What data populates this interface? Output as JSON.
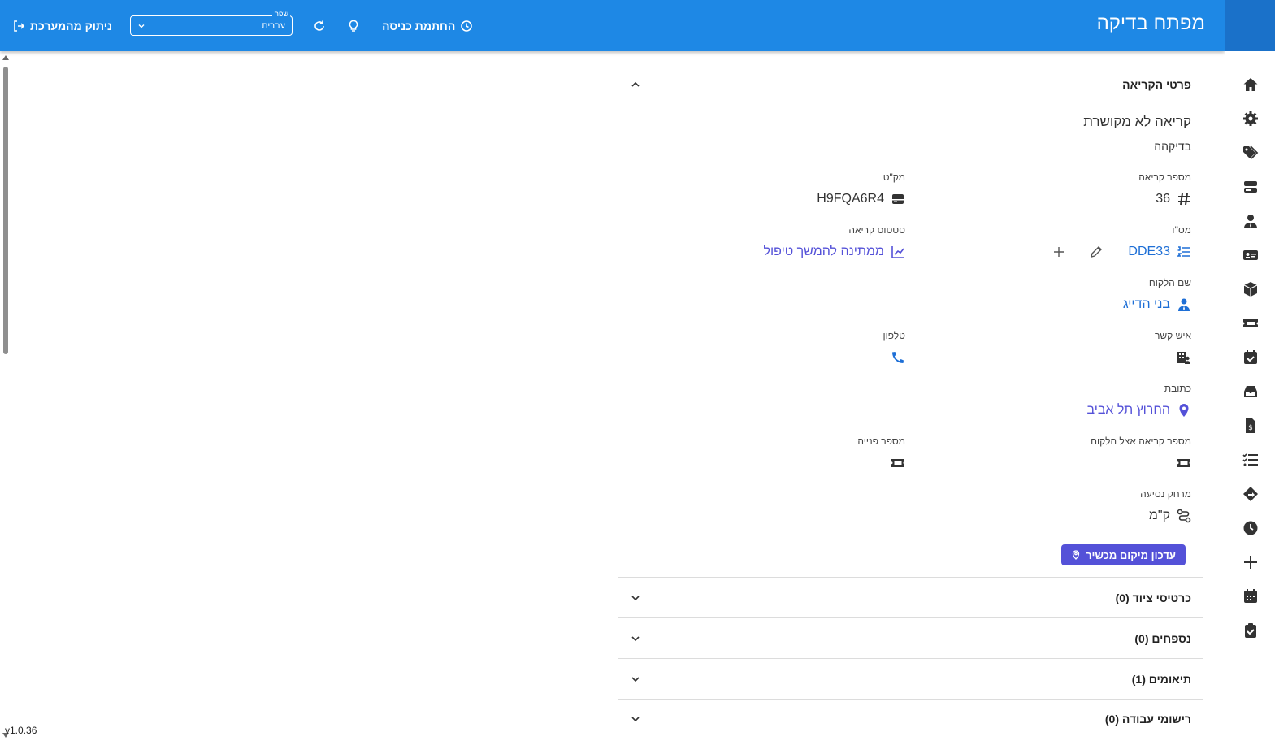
{
  "app": {
    "title": "מפתח בדיקה",
    "version": "v1.0.36"
  },
  "topbar": {
    "logout_label": "ניתוק מהמערכת",
    "language_legend": "שפה",
    "language_value": "עברית",
    "clock_in_label": "החתמת כניסה"
  },
  "sidebar": {
    "items": [
      "home-icon",
      "gear-icon",
      "tags-icon",
      "server-icon",
      "user-tie-icon",
      "id-card-icon",
      "box-icon",
      "ticket-icon",
      "calendar-check-icon",
      "inbox-icon",
      "file-invoice-dollar-icon",
      "list-check-icon",
      "route-sign-icon",
      "clock-icon",
      "plus-icon",
      "calendar-icon",
      "clipboard-check-icon"
    ]
  },
  "call_details": {
    "title": "פרטי הקריאה",
    "call_name": "קריאה לא מקושרת",
    "call_description": "בדיקהה",
    "fields": {
      "call_number": {
        "label": "מספר קריאה",
        "value": "36"
      },
      "sku": {
        "label": "מק\"ט",
        "value": "H9FQA6R4"
      },
      "serial": {
        "label": "מס\"ד",
        "value": "DDE33"
      },
      "status": {
        "label": "סטטוס קריאה",
        "value": "ממתינה להמשך טיפול"
      },
      "customer_name": {
        "label": "שם הלקוח",
        "value": "בני הדייג"
      },
      "contact_person": {
        "label": "איש קשר",
        "value": ""
      },
      "phone": {
        "label": "טלפון",
        "value": ""
      },
      "address": {
        "label": "כתובת",
        "value": "החרוץ תל אביב"
      },
      "customer_call_number": {
        "label": "מספר קריאה אצל הלקוח",
        "value": ""
      },
      "request_number": {
        "label": "מספר פנייה",
        "value": ""
      },
      "travel_distance": {
        "label": "מרחק נסיעה",
        "value": "ק\"מ"
      }
    },
    "update_location_button": "עדכון מיקום מכשיר"
  },
  "sections": [
    {
      "title": "כרטיסי ציוד (0)"
    },
    {
      "title": "נספחים (0)"
    },
    {
      "title": "תיאומים (1)"
    },
    {
      "title": "רישומי עבודה (0)"
    }
  ],
  "colors": {
    "header": "#1e88e5",
    "sidebar_header": "#1a71c9",
    "link": "#1e6fd6",
    "accent_button": "#5451d8"
  }
}
